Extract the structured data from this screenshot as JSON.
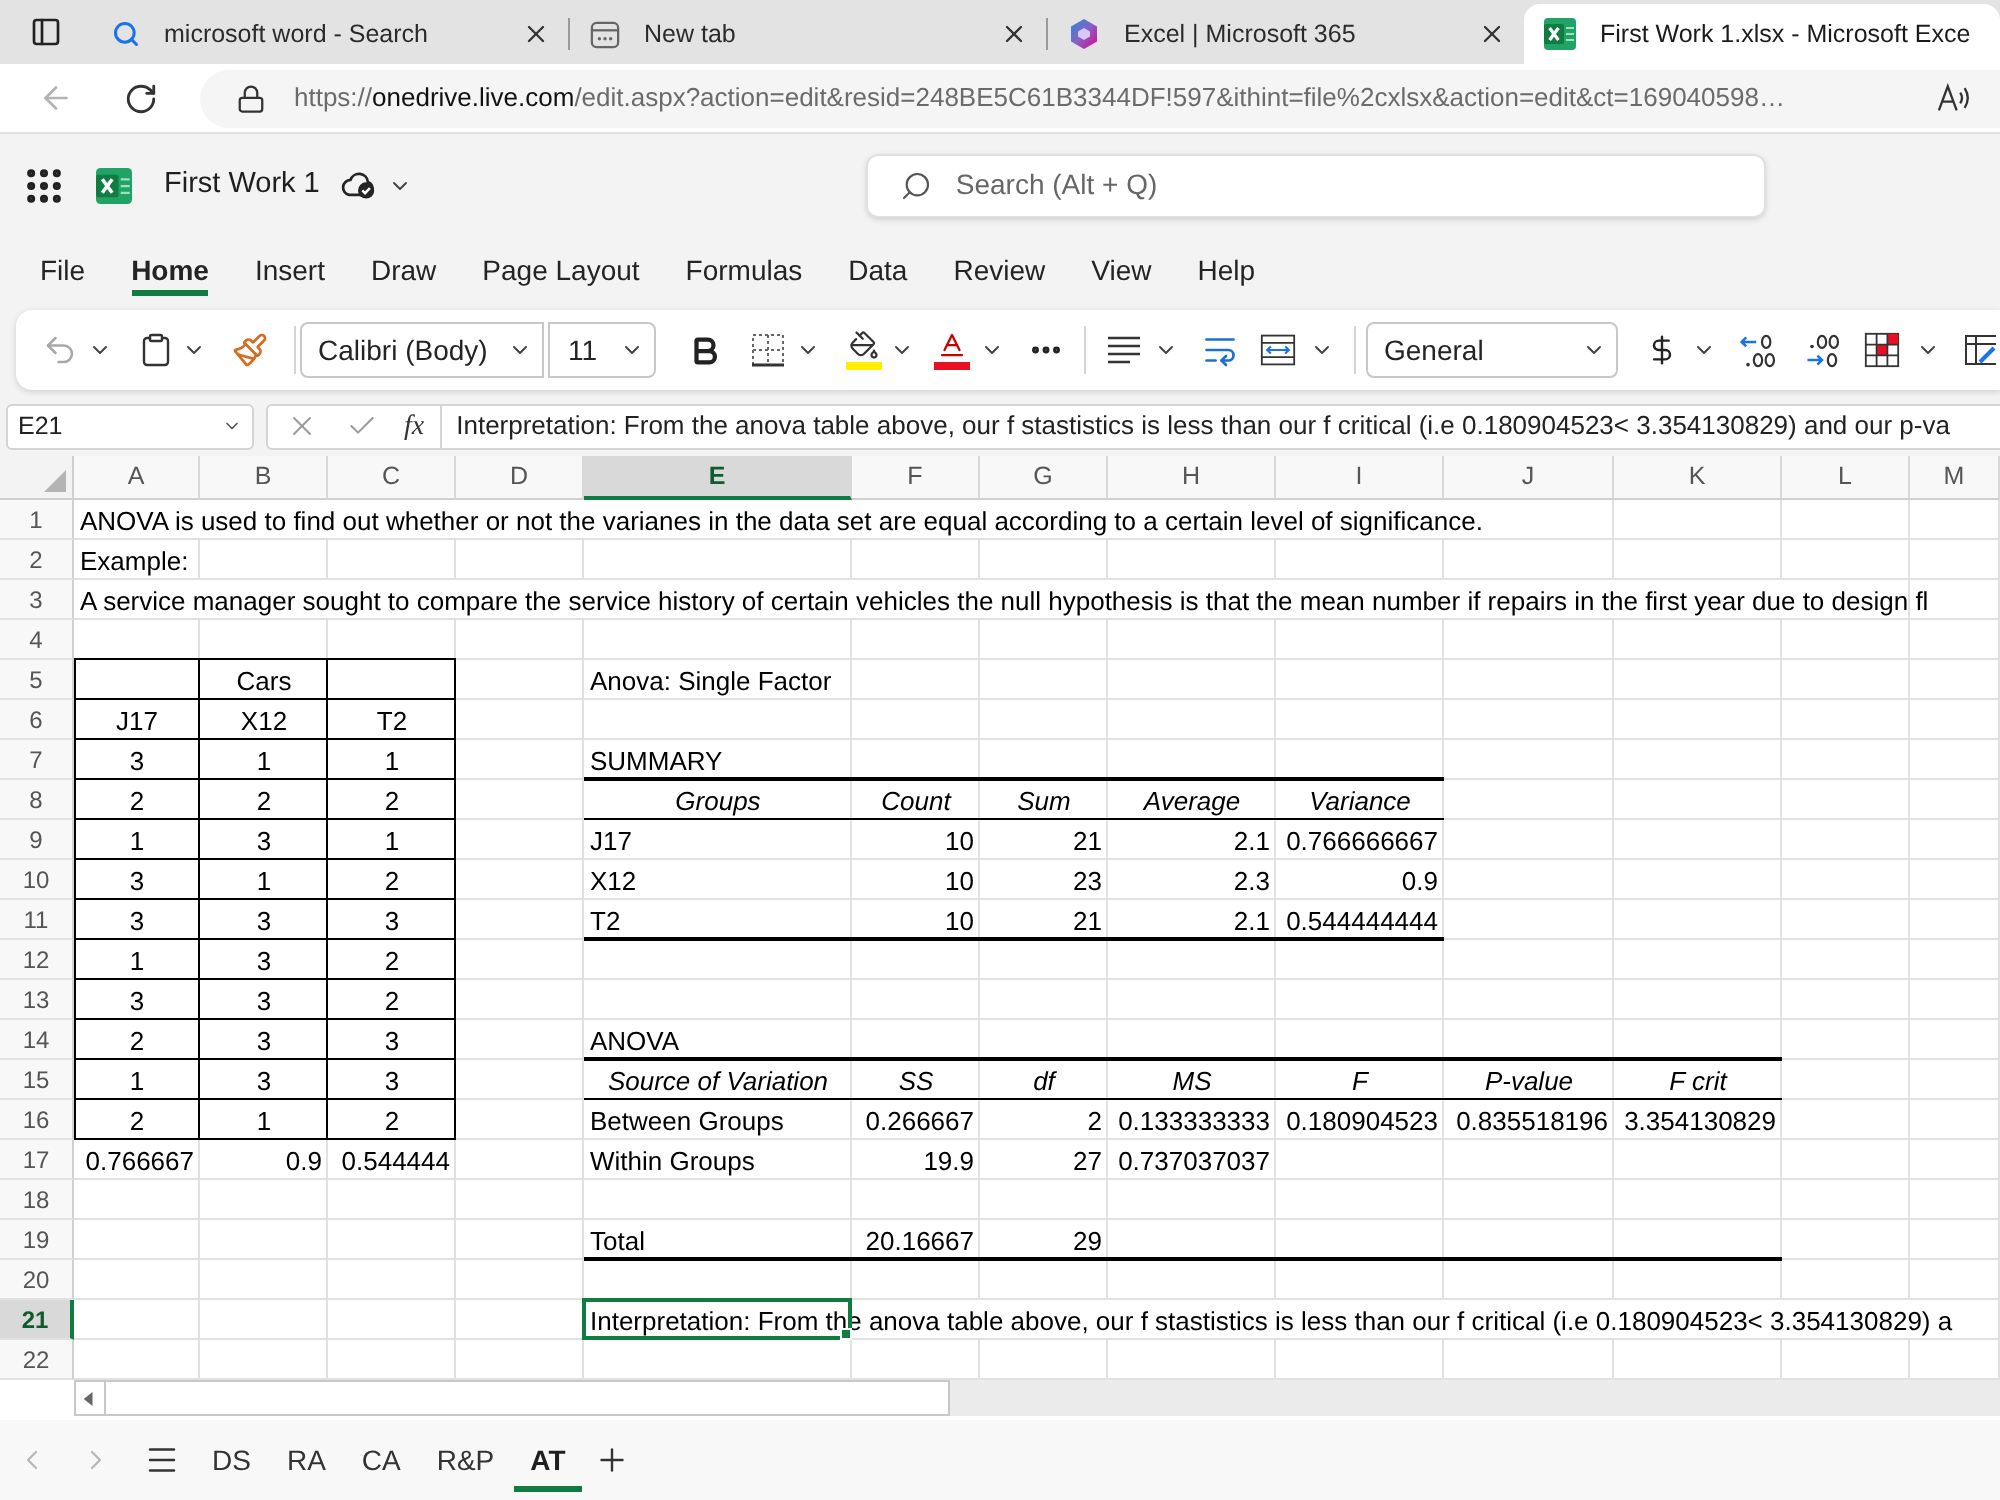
{
  "browser": {
    "tabs": [
      {
        "kind": "search",
        "title": "microsoft word - Search",
        "selected": false
      },
      {
        "kind": "new_tab",
        "title": "New tab",
        "selected": false
      },
      {
        "kind": "office",
        "title": "Excel | Microsoft 365",
        "selected": false
      },
      {
        "kind": "excel",
        "title": "First Work 1.xlsx - Microsoft Exce",
        "selected": true
      }
    ],
    "address": {
      "scheme": "https://",
      "host": "onedrive.live.com",
      "path": "/edit.aspx?action=edit&resid=248BE5C61B3344DF!597&ithint=file%2cxlsx&action=edit&ct=169040598…"
    }
  },
  "app_bar": {
    "file_name": "First Work 1",
    "search": {
      "placeholder": "Search (Alt + Q)"
    }
  },
  "menu_tabs": [
    {
      "label": "File",
      "selected": false
    },
    {
      "label": "Home",
      "selected": true
    },
    {
      "label": "Insert",
      "selected": false
    },
    {
      "label": "Draw",
      "selected": false
    },
    {
      "label": "Page Layout",
      "selected": false
    },
    {
      "label": "Formulas",
      "selected": false
    },
    {
      "label": "Data",
      "selected": false
    },
    {
      "label": "Review",
      "selected": false
    },
    {
      "label": "View",
      "selected": false
    },
    {
      "label": "Help",
      "selected": false
    }
  ],
  "ribbon": {
    "font_name": "Calibri (Body)",
    "font_size": "11",
    "number_format": "General"
  },
  "formula_bar": {
    "name_box": "E21",
    "function_label": "fx",
    "formula": "Interpretation: From the anova table above, our f stastistics is less than our f critical (i.e 0.180904523< 3.354130829) and our p-va"
  },
  "sheet": {
    "columns": [
      {
        "label": "A",
        "selected": false
      },
      {
        "label": "B",
        "selected": false
      },
      {
        "label": "C",
        "selected": false
      },
      {
        "label": "D",
        "selected": false
      },
      {
        "label": "E",
        "selected": true
      },
      {
        "label": "F",
        "selected": false
      },
      {
        "label": "G",
        "selected": false
      },
      {
        "label": "H",
        "selected": false
      },
      {
        "label": "I",
        "selected": false
      },
      {
        "label": "J",
        "selected": false
      },
      {
        "label": "K",
        "selected": false
      },
      {
        "label": "L",
        "selected": false
      },
      {
        "label": "M",
        "selected": false
      }
    ],
    "rows": [
      {
        "label": "1",
        "selected": false
      },
      {
        "label": "2",
        "selected": false
      },
      {
        "label": "3",
        "selected": false
      },
      {
        "label": "4",
        "selected": false
      },
      {
        "label": "5",
        "selected": false
      },
      {
        "label": "6",
        "selected": false
      },
      {
        "label": "7",
        "selected": false
      },
      {
        "label": "8",
        "selected": false
      },
      {
        "label": "9",
        "selected": false
      },
      {
        "label": "10",
        "selected": false
      },
      {
        "label": "11",
        "selected": false
      },
      {
        "label": "12",
        "selected": false
      },
      {
        "label": "13",
        "selected": false
      },
      {
        "label": "14",
        "selected": false
      },
      {
        "label": "15",
        "selected": false
      },
      {
        "label": "16",
        "selected": false
      },
      {
        "label": "17",
        "selected": false
      },
      {
        "label": "18",
        "selected": false
      },
      {
        "label": "19",
        "selected": false
      },
      {
        "label": "20",
        "selected": false
      },
      {
        "label": "21",
        "selected": true
      },
      {
        "label": "22",
        "selected": false
      }
    ],
    "notes": [
      "ANOVA is used to find out whether or not the varianes in the data set are equal according to a certain level of significance.",
      "Example:",
      "A service manager sought to compare the service history of certain vehicles the null hypothesis is that the mean number if repairs in the first year due to design fl"
    ],
    "cars_table": {
      "title": "Cars",
      "headers": [
        "J17",
        "X12",
        "T2"
      ],
      "rows": [
        [
          "3",
          "1",
          "1"
        ],
        [
          "2",
          "2",
          "2"
        ],
        [
          "1",
          "3",
          "1"
        ],
        [
          "3",
          "1",
          "2"
        ],
        [
          "3",
          "3",
          "3"
        ],
        [
          "1",
          "3",
          "2"
        ],
        [
          "3",
          "3",
          "2"
        ],
        [
          "2",
          "3",
          "3"
        ],
        [
          "1",
          "3",
          "3"
        ],
        [
          "2",
          "1",
          "2"
        ]
      ],
      "variances": [
        "0.766667",
        "0.9",
        "0.544444"
      ]
    },
    "summary": {
      "title": "Anova: Single Factor",
      "label": "SUMMARY",
      "headers": [
        "Groups",
        "Count",
        "Sum",
        "Average",
        "Variance"
      ],
      "rows": [
        [
          "J17",
          "10",
          "21",
          "2.1",
          "0.766666667"
        ],
        [
          "X12",
          "10",
          "23",
          "2.3",
          "0.9"
        ],
        [
          "T2",
          "10",
          "21",
          "2.1",
          "0.544444444"
        ]
      ]
    },
    "anova": {
      "label": "ANOVA",
      "headers": [
        "Source of Variation",
        "SS",
        "df",
        "MS",
        "F",
        "P-value",
        "F crit"
      ],
      "rows": [
        [
          "Between Groups",
          "0.266667",
          "2",
          "0.133333333",
          "0.180904523",
          "0.835518196",
          "3.354130829"
        ],
        [
          "Within Groups",
          "19.9",
          "27",
          "0.737037037"
        ]
      ],
      "total": [
        "Total",
        "20.16667",
        "29"
      ]
    },
    "interpretation": "Interpretation: From the anova table above, our f stastistics is less than our f critical (i.e 0.180904523< 3.354130829) a"
  },
  "sheet_tabs": [
    {
      "label": "DS",
      "selected": false
    },
    {
      "label": "RA",
      "selected": false
    },
    {
      "label": "CA",
      "selected": false
    },
    {
      "label": "R&P",
      "selected": false
    },
    {
      "label": "AT",
      "selected": true
    }
  ]
}
